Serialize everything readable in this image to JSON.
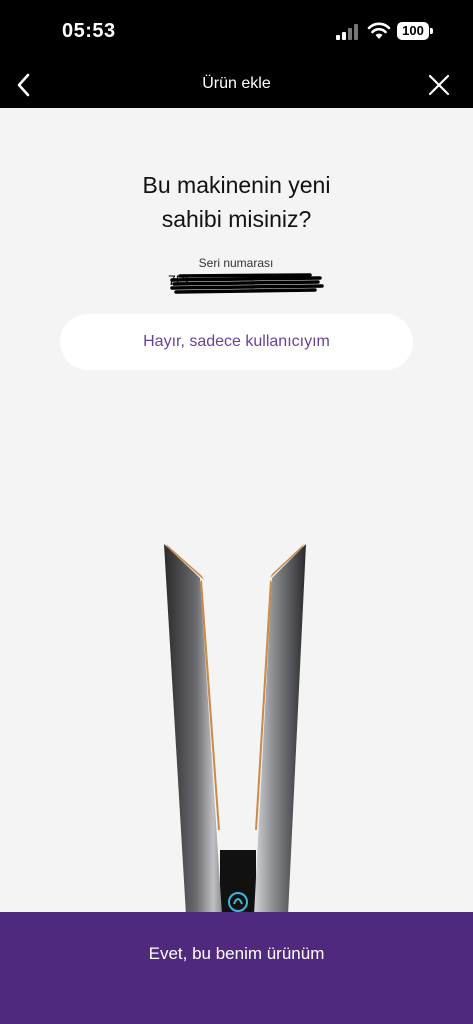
{
  "status_bar": {
    "time": "05:53",
    "battery": "100",
    "icons": [
      "signal-icon",
      "wifi-icon",
      "battery-icon"
    ]
  },
  "nav": {
    "title": "Ürün ekle",
    "back_icon": "chevron-left-icon",
    "close_icon": "close-icon"
  },
  "main": {
    "question_line1": "Bu makinenin yeni",
    "question_line2": "sahibi misiniz?",
    "serial_label": "Seri numarası",
    "serial_value_visible": "7PL",
    "secondary_button_label": "Hayır, sadece kullanıcıyım",
    "product_image_icon": "hair-straightener-image"
  },
  "footer": {
    "primary_button_label": "Evet, bu benim ürünüm"
  },
  "colors": {
    "accent": "#50297f",
    "link": "#6b3fa0",
    "background": "#f4f4f4",
    "nav_bg": "#000000",
    "copper": "#c98a4b"
  }
}
